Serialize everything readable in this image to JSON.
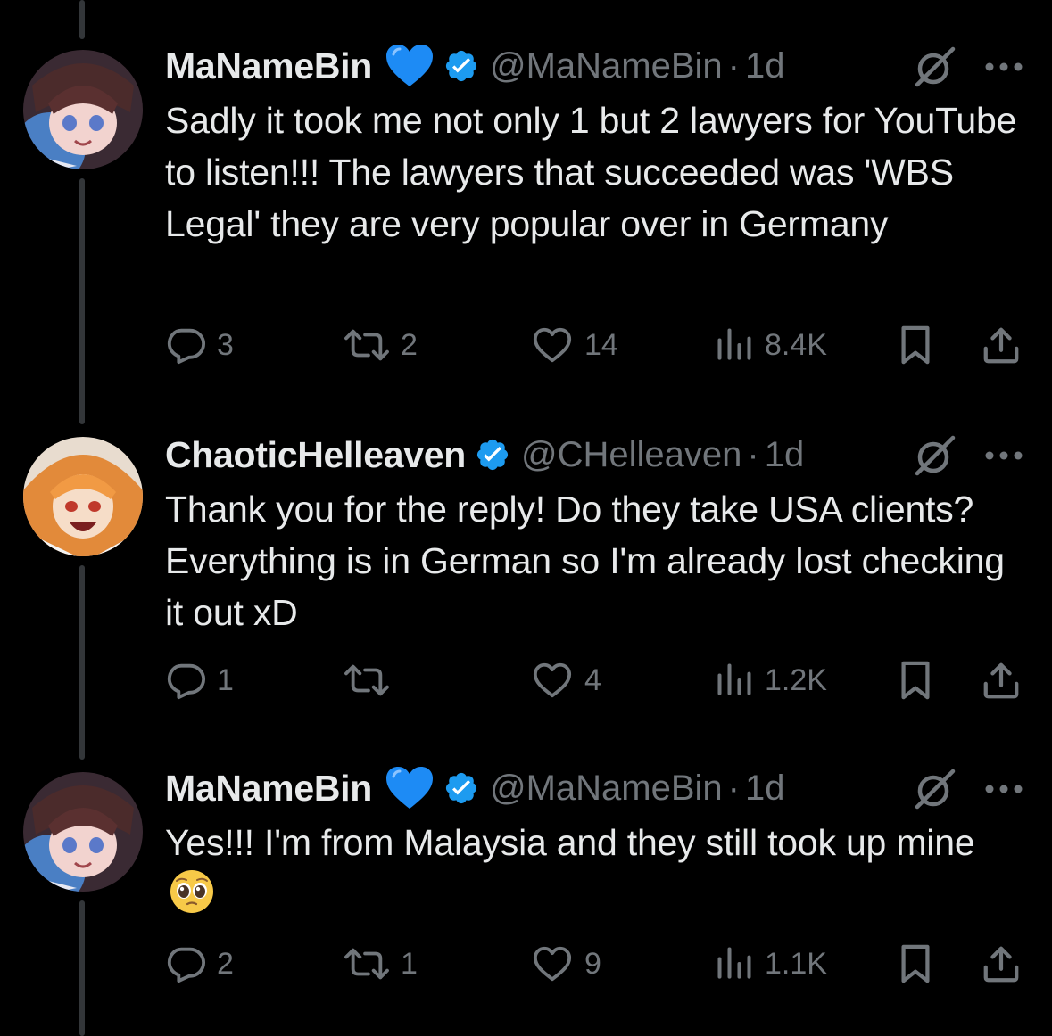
{
  "tweets": [
    {
      "name": "MaNameBin",
      "has_heart": true,
      "handle": "@MaNameBin",
      "time": "1d",
      "text": "Sadly it took me not only 1 but 2 lawyers for YouTube to listen!!! The lawyers that succeeded was 'WBS Legal' they are very popular over in Germany",
      "replies": "3",
      "reposts": "2",
      "likes": "14",
      "views": "8.4K"
    },
    {
      "name": "ChaoticHelleaven",
      "has_heart": false,
      "handle": "@CHelleaven",
      "time": "1d",
      "text": "Thank you for the reply! Do they take USA clients? Everything is in German so I'm already lost checking it out xD",
      "replies": "1",
      "reposts": "",
      "likes": "4",
      "views": "1.2K"
    },
    {
      "name": "MaNameBin",
      "has_heart": true,
      "handle": "@MaNameBin",
      "time": "1d",
      "text": "Yes!!! I'm from Malaysia and they still took up mine",
      "emoji": "pleading-face",
      "replies": "2",
      "reposts": "1",
      "likes": "9",
      "views": "1.1K"
    }
  ],
  "separator": "·",
  "colors": {
    "background": "#000000",
    "text": "#e7e9ea",
    "muted": "#71767b",
    "verified": "#1d9bf0",
    "heart_emoji": "#1d8bf5",
    "thread_line": "#333639"
  },
  "icons": [
    "reply-icon",
    "repost-icon",
    "like-icon",
    "views-icon",
    "bookmark-icon",
    "share-icon",
    "grok-icon",
    "more-icon",
    "verified-icon",
    "blue-heart-emoji"
  ]
}
